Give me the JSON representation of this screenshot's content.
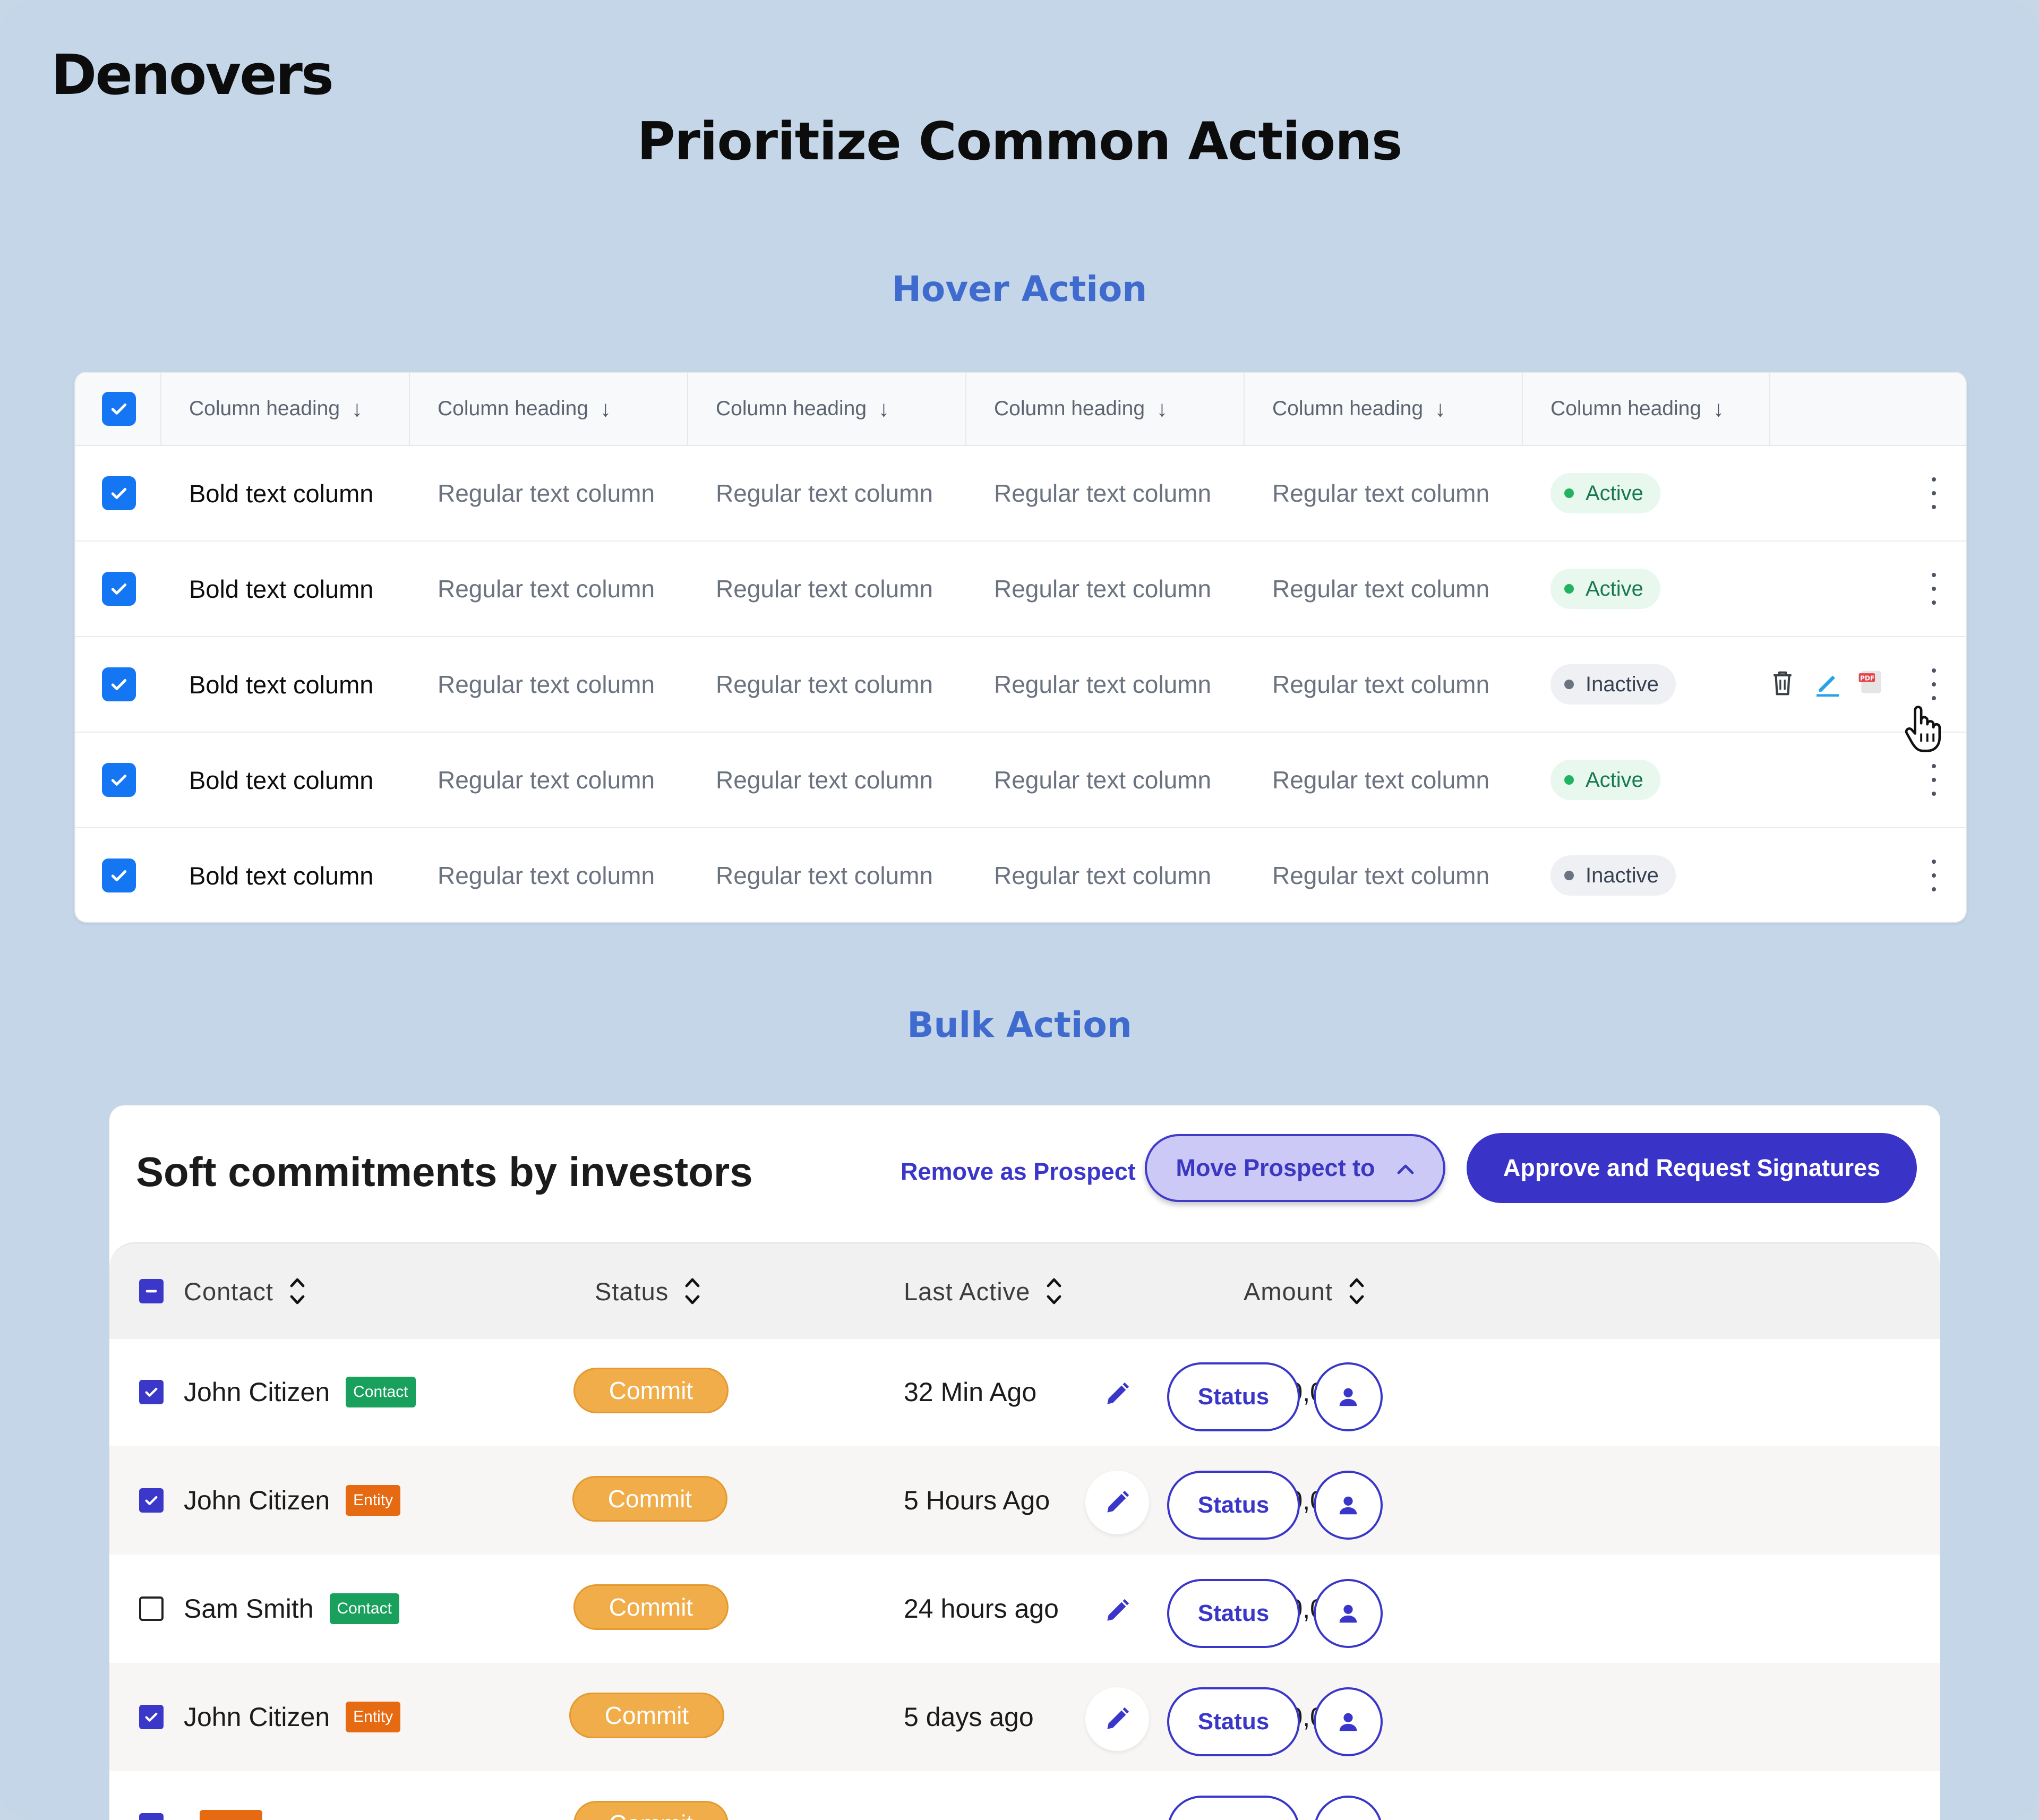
{
  "brand": "Denovers",
  "page_title": "Prioritize Common Actions",
  "hover_section": {
    "title": "Hover Action",
    "column_headings": [
      "Column heading",
      "Column heading",
      "Column heading",
      "Column heading",
      "Column heading",
      "Column heading"
    ],
    "rows": [
      {
        "bold": "Bold text column",
        "cells": [
          "Regular text column",
          "Regular text column",
          "Regular text column",
          "Regular text column"
        ],
        "status": "Active"
      },
      {
        "bold": "Bold text column",
        "cells": [
          "Regular text column",
          "Regular text column",
          "Regular text column",
          "Regular text column"
        ],
        "status": "Active"
      },
      {
        "bold": "Bold text column",
        "cells": [
          "Regular text column",
          "Regular text column",
          "Regular text column",
          "Regular text column"
        ],
        "status": "Inactive"
      },
      {
        "bold": "Bold text column",
        "cells": [
          "Regular text column",
          "Regular text column",
          "Regular text column",
          "Regular text column"
        ],
        "status": "Active"
      },
      {
        "bold": "Bold text column",
        "cells": [
          "Regular text column",
          "Regular text column",
          "Regular text column",
          "Regular text column"
        ],
        "status": "Inactive"
      }
    ],
    "hover_icons": [
      "trash-icon",
      "pencil-icon",
      "pdf-icon",
      "hand-pointer-icon"
    ],
    "colors": {
      "checkbox": "#1476f2",
      "active": "#22b35e"
    }
  },
  "bulk_section": {
    "title": "Bulk Action",
    "card_title": "Soft commitments by investors",
    "remove_label": "Remove as Prospect",
    "move_label": "Move Prospect to",
    "approve_label": "Approve and Request Signatures",
    "headers": {
      "contact": "Contact",
      "status": "Status",
      "last_active": "Last Active",
      "amount": "Amount"
    },
    "rows": [
      {
        "checked": true,
        "name": "John Citizen",
        "tag": "Contact",
        "status": "Commit",
        "last_active": "32 Min Ago",
        "amount": "$150,000",
        "action": "Status"
      },
      {
        "checked": true,
        "name": "John Citizen",
        "tag": "Entity",
        "status": "Commit",
        "last_active": "5 Hours Ago",
        "amount": "$250,000",
        "action": "Status"
      },
      {
        "checked": false,
        "name": "Sam Smith",
        "tag": "Contact",
        "status": "Commit",
        "last_active": "24 hours ago",
        "amount": "$150,000",
        "action": "Status"
      },
      {
        "checked": true,
        "name": "John Citizen",
        "tag": "Entity",
        "status": "Commit",
        "last_active": "5 days ago",
        "amount": "$250,000",
        "action": "Status"
      },
      {
        "checked": true,
        "name": "",
        "tag": "",
        "status": "Commit",
        "last_active": "",
        "amount": "",
        "action": "Status"
      }
    ],
    "colors": {
      "primary": "#3a33c7",
      "commit": "#f0ad4a",
      "contact_tag": "#1aa05d",
      "entity_tag": "#e66a12"
    }
  }
}
